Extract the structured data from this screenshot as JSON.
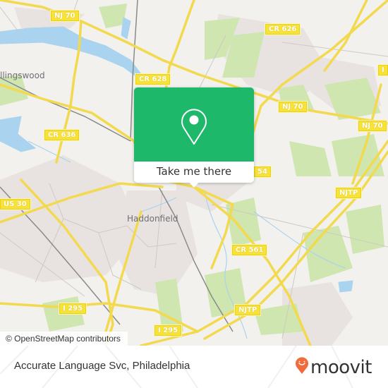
{
  "map": {
    "road_labels": [
      {
        "id": "nj70-nw",
        "text": "NJ 70"
      },
      {
        "id": "cr626",
        "text": "CR 626"
      },
      {
        "id": "cr628",
        "text": "CR 628"
      },
      {
        "id": "nj70-center",
        "text": "NJ 70"
      },
      {
        "id": "nj70-right",
        "text": "NJ 70"
      },
      {
        "id": "nj70-far",
        "text": "NJ 70"
      },
      {
        "id": "cr636",
        "text": "CR 636"
      },
      {
        "id": "us30",
        "text": "US 30"
      },
      {
        "id": "cr554",
        "text": "54"
      },
      {
        "id": "njtp-upper",
        "text": "NJTP"
      },
      {
        "id": "cr561",
        "text": "CR 561"
      },
      {
        "id": "i295-left",
        "text": "I 295"
      },
      {
        "id": "njtp-lower",
        "text": "NJTP"
      },
      {
        "id": "i295-bottom",
        "text": "I 295"
      },
      {
        "id": "i-edge",
        "text": "I"
      }
    ],
    "places": [
      {
        "id": "collingswood",
        "text": "llingswood"
      },
      {
        "id": "haddonfield",
        "text": "Haddonfield"
      }
    ],
    "attribution": "© OpenStreetMap contributors"
  },
  "popup": {
    "button_label": "Take me there",
    "color": "#1eb86a"
  },
  "footer": {
    "title": "Accurate Language Svc, Philadelphia",
    "brand": "moovit",
    "brand_color": "#f26b3a"
  }
}
